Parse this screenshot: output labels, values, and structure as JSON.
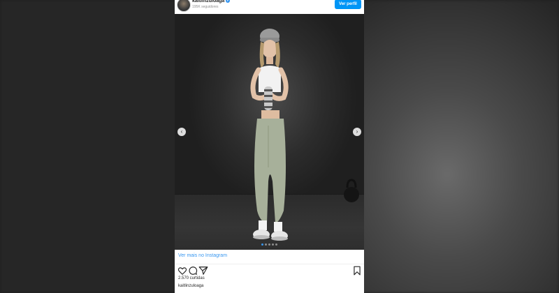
{
  "header": {
    "username": "kaitlinzuloaga",
    "followers": "195K seguidores",
    "profile_button": "Ver perfil"
  },
  "post": {
    "carousel_dots": 5,
    "active_dot": 1
  },
  "footer": {
    "view_more_link": "Ver mais no Instagram",
    "likes": "2.570 curtidas",
    "caption_user": "kaitlinzuloaga"
  },
  "icons": {
    "like": "heart-icon",
    "comment": "comment-icon",
    "share": "share-icon",
    "save": "bookmark-icon",
    "prev": "chevron-left-icon",
    "next": "chevron-right-icon",
    "verified": "verified-badge-icon"
  },
  "colors": {
    "accent": "#0095f6",
    "link": "#3897f0",
    "text": "#262626",
    "muted": "#8e8e8e"
  }
}
